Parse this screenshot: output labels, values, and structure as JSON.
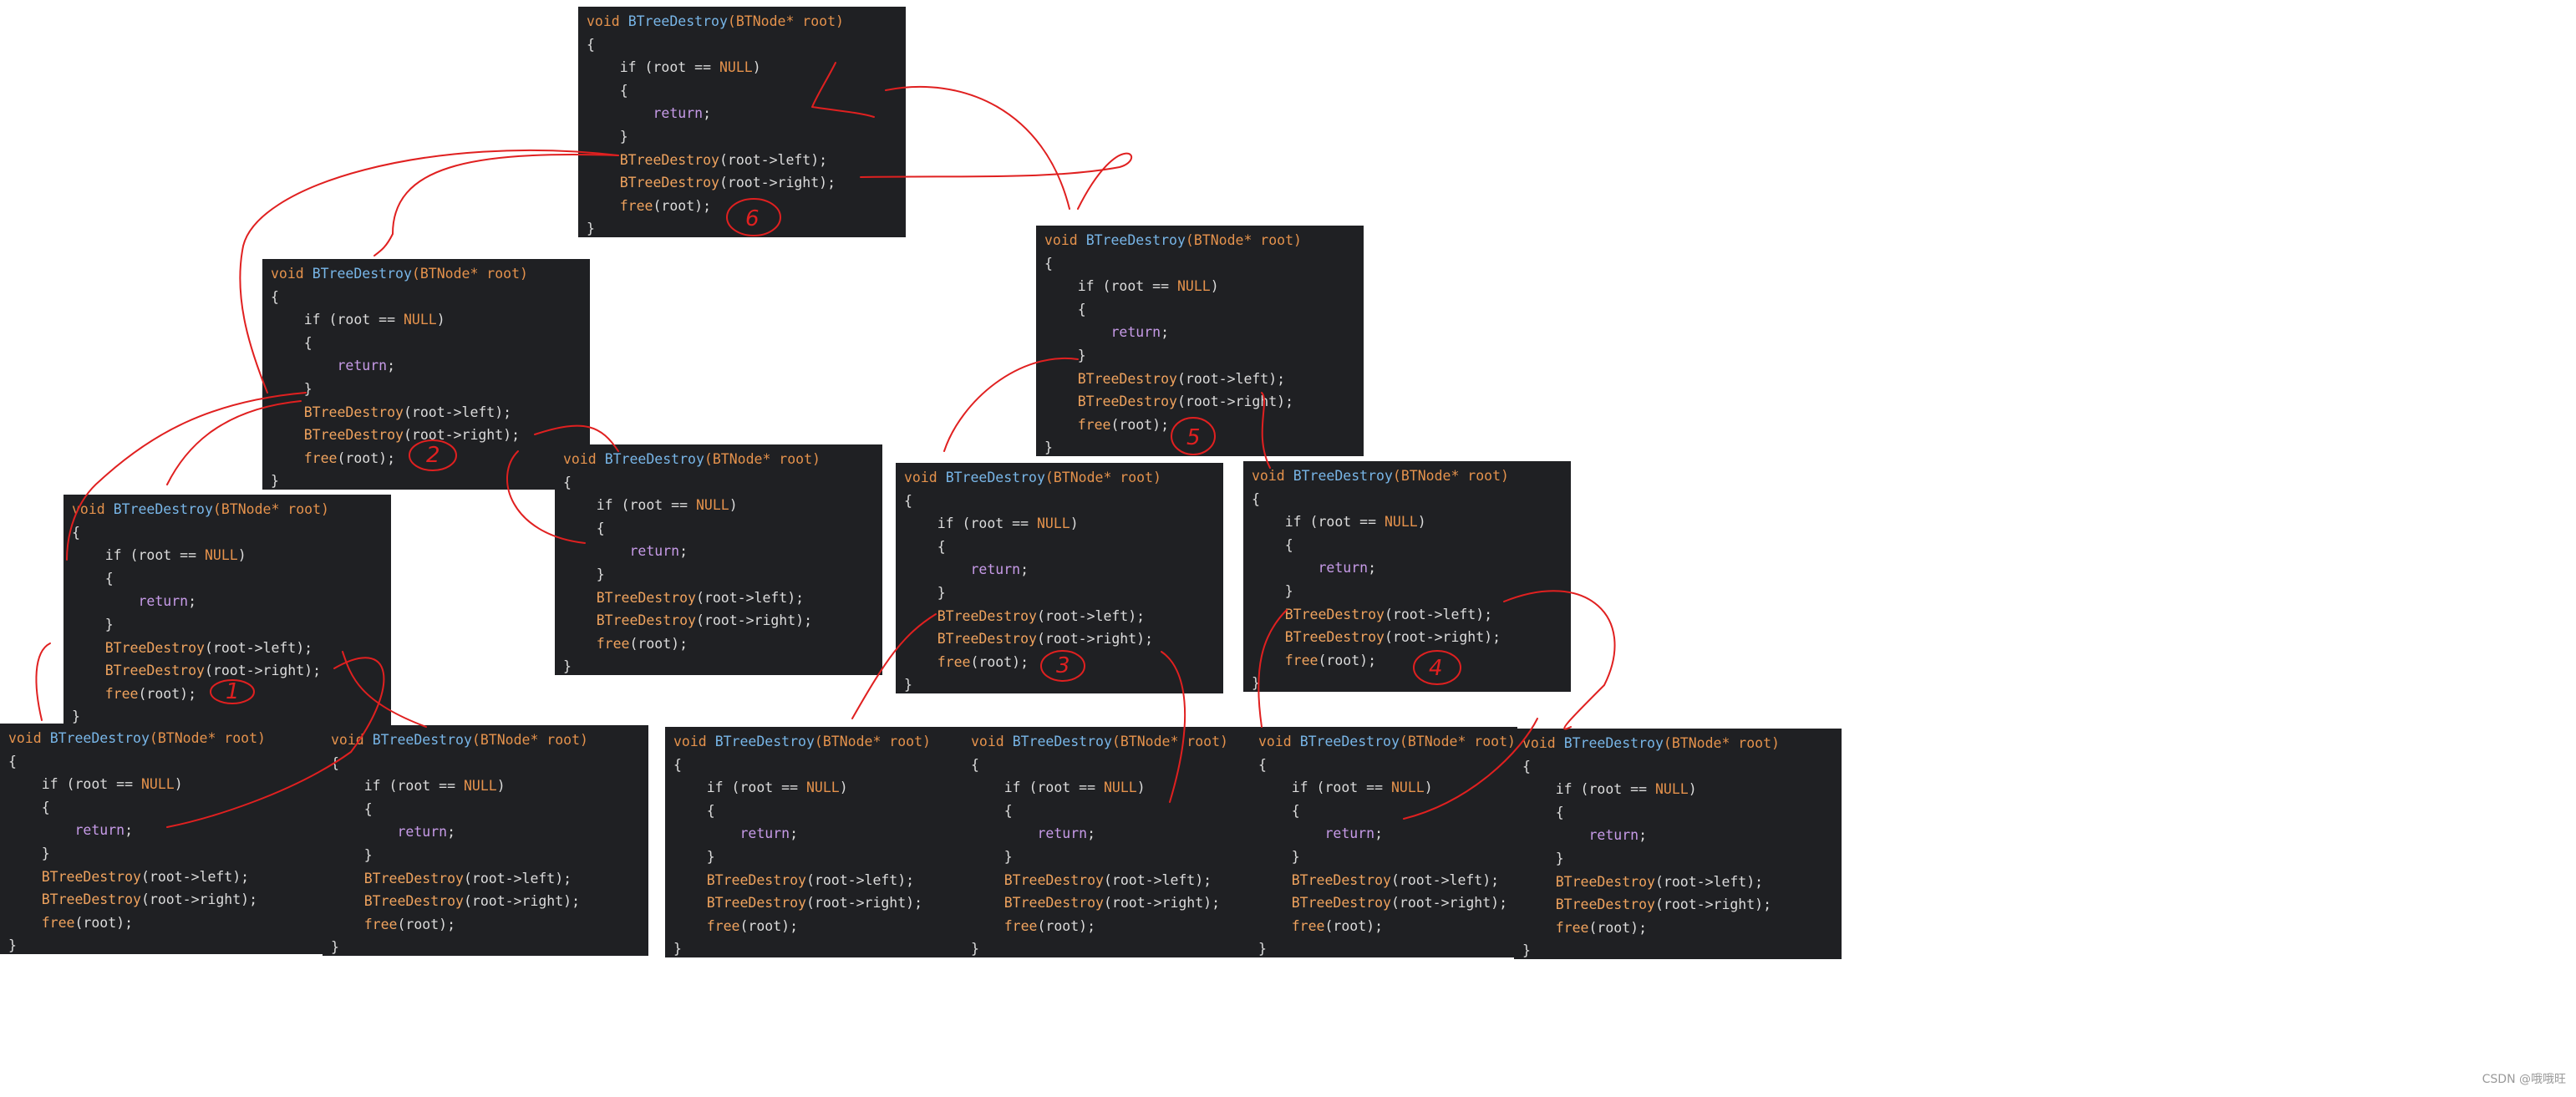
{
  "code": {
    "sig_void": "void",
    "sig_fn": "BTreeDestroy",
    "sig_params": "(BTNode* root)",
    "open_brace": "{",
    "if_kw": "if",
    "if_cond_pre": " (root == ",
    "if_null": "NULL",
    "if_cond_post": ")",
    "inner_open": "{",
    "return_kw": "return",
    "return_semi": ";",
    "inner_close": "}",
    "call_left_fn": "BTreeDestroy",
    "call_left_args": "(root->left);",
    "call_right_fn": "BTreeDestroy",
    "call_right_args": "(root->right);",
    "free_fn": "free",
    "free_args": "(root);",
    "close_brace": "}"
  },
  "boxes": [
    {
      "id": "root-call"
    },
    {
      "id": "left-call"
    },
    {
      "id": "right-call"
    },
    {
      "id": "left-left-call"
    },
    {
      "id": "left-right-call"
    },
    {
      "id": "right-left-call"
    },
    {
      "id": "right-right-call"
    },
    {
      "id": "null-call-1"
    },
    {
      "id": "null-call-2"
    },
    {
      "id": "null-call-3"
    },
    {
      "id": "null-call-4"
    },
    {
      "id": "null-call-5"
    },
    {
      "id": "null-call-6"
    }
  ],
  "annotations": {
    "order_marks": [
      "1",
      "2",
      "3",
      "4",
      "5",
      "6"
    ],
    "ink_color": "#e02020"
  },
  "watermark": "CSDN @哦哦旺"
}
